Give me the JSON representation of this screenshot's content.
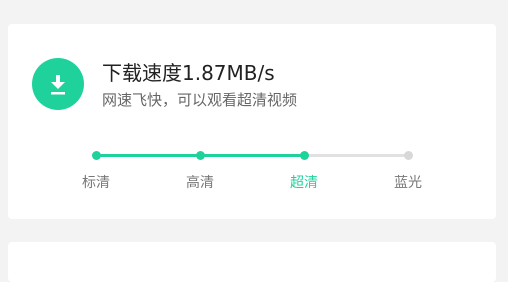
{
  "speed_card": {
    "title": "下载速度1.87MB/s",
    "subtitle": "网速飞快，可以观看超清视频",
    "icon": "download-icon"
  },
  "quality": {
    "options": [
      "标清",
      "高清",
      "超清",
      "蓝光"
    ],
    "selected_index": 2,
    "progress_fraction": 0.667
  },
  "colors": {
    "accent": "#1fd29c",
    "track": "#e1e1e1",
    "inactive_dot": "#d8d8d8"
  }
}
